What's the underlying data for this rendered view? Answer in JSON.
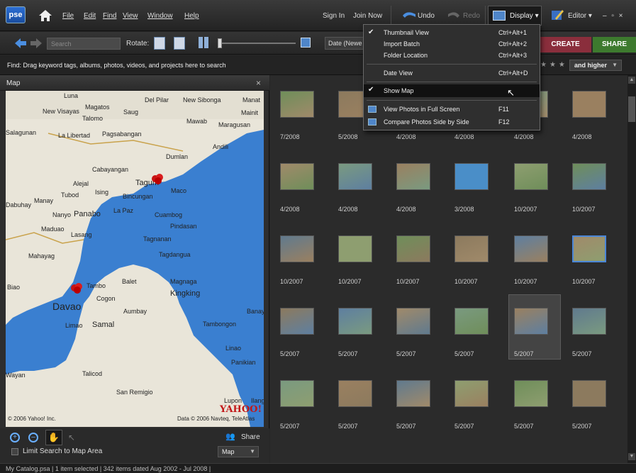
{
  "menubar": {
    "logo": "pse",
    "menus": [
      "File",
      "Edit",
      "Find",
      "View",
      "Window",
      "Help"
    ],
    "sign_in": "Sign In",
    "join_now": "Join Now",
    "undo": "Undo",
    "redo": "Redo",
    "display": "Display ▾",
    "editor": "Editor ▾",
    "window_controls": "– ▫ ×"
  },
  "toolbar": {
    "search_placeholder": "Search",
    "rotate": "Rotate:",
    "sort": "Date (Newe",
    "create": "CREATE",
    "share": "SHARE"
  },
  "findbar": {
    "text": "Find: Drag keyword tags, albums, photos, videos, and projects here to search",
    "rating": "and higher"
  },
  "map": {
    "title": "Map",
    "close": "×",
    "copyright": "© 2006 Yahoo! Inc.",
    "data_credit": "Data © 2006 Navteq, TeleAtlas",
    "provider": "YAHOO!",
    "share": "Share",
    "limit_label": "Limit Search to Map Area",
    "mode": "Map",
    "places": [
      "Luna",
      "Del Pilar",
      "New Sibonga",
      "Manat",
      "New Visayas",
      "Magatos",
      "Saug",
      "Mainit",
      "Talomo",
      "Mawab",
      "Maragusan",
      "Salagunan",
      "La Libertad",
      "Pagsabangan",
      "Andili",
      "Dumlan",
      "Cabayangan",
      "Alejal",
      "Tagum",
      "Maco",
      "Ising",
      "Bincungan",
      "Tubod",
      "Manay",
      "Dabuhay",
      "Nanyo",
      "Panabo",
      "La Paz",
      "Cuambog",
      "Pindasan",
      "Maduao",
      "Lasang",
      "Tagnanan",
      "Mahayag",
      "Tagdangua",
      "Balet",
      "Magnaga",
      "Biao",
      "Tambo",
      "Kingking",
      "Cogon",
      "Davao",
      "Aumbay",
      "Banay",
      "Limao",
      "Samal",
      "Tambongon",
      "Linao",
      "Panikian",
      "Wayan",
      "Talicod",
      "San Remigio",
      "Lupon",
      "Ilang"
    ]
  },
  "grid": {
    "rows": [
      [
        "7/2008",
        "5/2008",
        "4/2008",
        "4/2008",
        "4/2008",
        "4/2008"
      ],
      [
        "4/2008",
        "4/2008",
        "4/2008",
        "3/2008",
        "10/2007",
        "10/2007"
      ],
      [
        "10/2007",
        "10/2007",
        "10/2007",
        "10/2007",
        "10/2007",
        "10/2007"
      ],
      [
        "5/2007",
        "5/2007",
        "5/2007",
        "5/2007",
        "5/2007",
        "5/2007"
      ],
      [
        "5/2007",
        "5/2007",
        "5/2007",
        "5/2007",
        "5/2007",
        "5/2007"
      ]
    ]
  },
  "display_menu": {
    "items": [
      {
        "label": "Thumbnail View",
        "shortcut": "Ctrl+Alt+1",
        "checked": true
      },
      {
        "label": "Import Batch",
        "shortcut": "Ctrl+Alt+2"
      },
      {
        "label": "Folder Location",
        "shortcut": "Ctrl+Alt+3"
      },
      {
        "label": "Date View",
        "shortcut": "Ctrl+Alt+D"
      },
      {
        "label": "Show Map",
        "shortcut": "",
        "checked": true,
        "highlighted": true
      },
      {
        "label": "View Photos in Full Screen",
        "shortcut": "F11"
      },
      {
        "label": "Compare Photos Side by Side",
        "shortcut": "F12"
      }
    ]
  },
  "status": {
    "text": "My Catalog.psa  |  1 item selected  |  342 items dated Aug 2002 - Jul 2008  |"
  },
  "colors": {
    "accent": "#2b6ed4",
    "create": "#8a2e3c",
    "share": "#3d7a2e",
    "water": "#3a7fd0",
    "land": "#e8e4d8"
  }
}
